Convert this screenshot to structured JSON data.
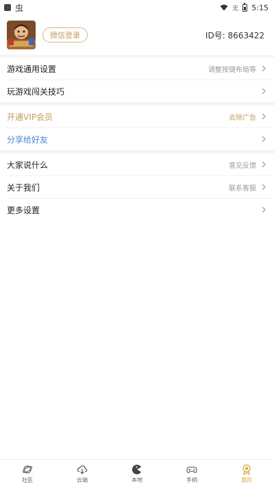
{
  "status_bar": {
    "bug_glyph": "虫",
    "sim_text": "无",
    "time": "5:15"
  },
  "profile": {
    "login_label": "微信登录",
    "id_text": "ID号: 8663422"
  },
  "menu": {
    "game_settings": {
      "label": "游戏通用设置",
      "hint": "调整按键布局等"
    },
    "game_tips": {
      "label": "玩游戏闯关技巧"
    },
    "vip": {
      "label": "开通VIP会员",
      "hint": "去除广告"
    },
    "share": {
      "label": "分享给好友"
    },
    "feedback": {
      "label": "大家说什么",
      "hint": "意见反馈"
    },
    "about": {
      "label": "关于我们",
      "hint": "联系客服"
    },
    "more": {
      "label": "更多设置"
    }
  },
  "bottom_nav": {
    "items": [
      {
        "label": "社区",
        "icon": "planet-icon"
      },
      {
        "label": "云端",
        "icon": "cloud-download-icon"
      },
      {
        "label": "本地",
        "icon": "pacman-icon"
      },
      {
        "label": "手柄",
        "icon": "gamepad-icon"
      },
      {
        "label": "我的",
        "icon": "medal-icon"
      }
    ],
    "active_index": 4
  },
  "colors": {
    "accent_gold": "#c59d5f",
    "link_blue": "#4a88d6",
    "active_nav": "#d9a93a"
  }
}
